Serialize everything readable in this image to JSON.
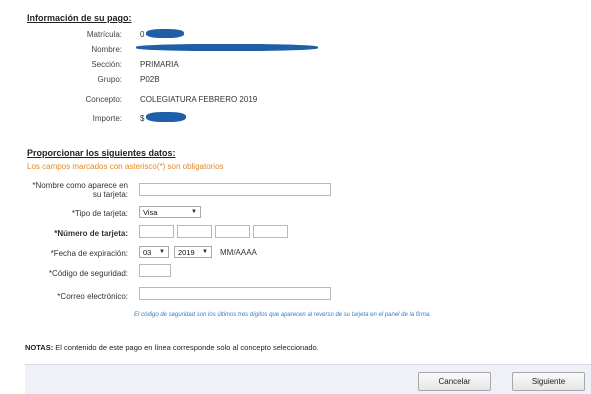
{
  "payment_info": {
    "title": "Información de su pago:",
    "rows": [
      {
        "label": "Matrícula:",
        "value": "0"
      },
      {
        "label": "Nombre:",
        "value": ""
      },
      {
        "label": "Sección:",
        "value": "PRIMARIA"
      },
      {
        "label": "Grupo:",
        "value": "P02B"
      },
      {
        "label": "Concepto:",
        "value": "COLEGIATURA FEBRERO 2019"
      },
      {
        "label": "Importe:",
        "value": "$"
      }
    ]
  },
  "form": {
    "title": "Proporcionar los siguientes datos:",
    "required_note": "Los campos marcados con asterisco(*) son obligatorios",
    "name_label": "*Nombre como aparece en su tarjeta:",
    "card_type_label": "*Tipo de tarjeta:",
    "card_type_value": "Visa",
    "card_number_label": "*Número de tarjeta:",
    "expiration_label": "*Fecha de expiración:",
    "exp_month": "03",
    "exp_year": "2019",
    "exp_format": "MM/AAAA",
    "security_code_label": "*Código de seguridad:",
    "email_label": "*Correo electrónico:",
    "security_hint": "El código de seguridad son los últimos tres dígitos que aparecen al reverso de su tarjeta en el panel de la firma."
  },
  "notes": {
    "label": "NOTAS:",
    "text": "El contenido de este pago en línea corresponde solo al concepto seleccionado."
  },
  "buttons": {
    "cancel": "Cancelar",
    "next": "Siguiente"
  },
  "colors": {
    "redaction": "#1f5fa8",
    "warning": "#e08a2a",
    "hint": "#3a7bbf",
    "footer_bg": "#eef1f7"
  }
}
